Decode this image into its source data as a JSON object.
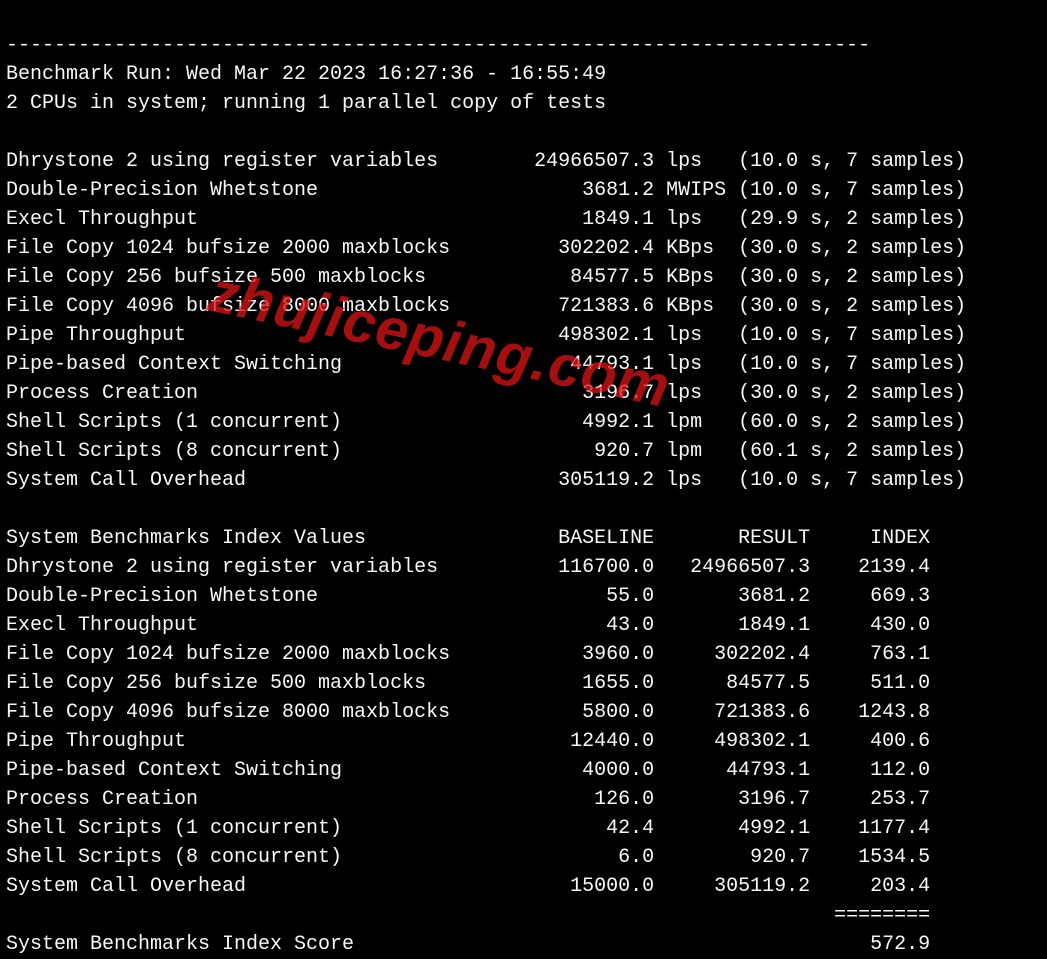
{
  "header": {
    "dashes": "------------------------------------------------------------------------",
    "run_line": "Benchmark Run: Wed Mar 22 2023 16:27:36 - 16:55:49",
    "cpu_line": "2 CPUs in system; running 1 parallel copy of tests"
  },
  "tests": [
    {
      "name": "Dhrystone 2 using register variables",
      "value": "24966507.3",
      "unit": "lps",
      "timing": "(10.0 s, 7 samples)"
    },
    {
      "name": "Double-Precision Whetstone",
      "value": "3681.2",
      "unit": "MWIPS",
      "timing": "(10.0 s, 7 samples)"
    },
    {
      "name": "Execl Throughput",
      "value": "1849.1",
      "unit": "lps",
      "timing": "(29.9 s, 2 samples)"
    },
    {
      "name": "File Copy 1024 bufsize 2000 maxblocks",
      "value": "302202.4",
      "unit": "KBps",
      "timing": "(30.0 s, 2 samples)"
    },
    {
      "name": "File Copy 256 bufsize 500 maxblocks",
      "value": "84577.5",
      "unit": "KBps",
      "timing": "(30.0 s, 2 samples)"
    },
    {
      "name": "File Copy 4096 bufsize 8000 maxblocks",
      "value": "721383.6",
      "unit": "KBps",
      "timing": "(30.0 s, 2 samples)"
    },
    {
      "name": "Pipe Throughput",
      "value": "498302.1",
      "unit": "lps",
      "timing": "(10.0 s, 7 samples)"
    },
    {
      "name": "Pipe-based Context Switching",
      "value": "44793.1",
      "unit": "lps",
      "timing": "(10.0 s, 7 samples)"
    },
    {
      "name": "Process Creation",
      "value": "3196.7",
      "unit": "lps",
      "timing": "(30.0 s, 2 samples)"
    },
    {
      "name": "Shell Scripts (1 concurrent)",
      "value": "4992.1",
      "unit": "lpm",
      "timing": "(60.0 s, 2 samples)"
    },
    {
      "name": "Shell Scripts (8 concurrent)",
      "value": "920.7",
      "unit": "lpm",
      "timing": "(60.1 s, 2 samples)"
    },
    {
      "name": "System Call Overhead",
      "value": "305119.2",
      "unit": "lps",
      "timing": "(10.0 s, 7 samples)"
    }
  ],
  "index_header": {
    "title": "System Benchmarks Index Values",
    "col_baseline": "BASELINE",
    "col_result": "RESULT",
    "col_index": "INDEX"
  },
  "index": [
    {
      "name": "Dhrystone 2 using register variables",
      "baseline": "116700.0",
      "result": "24966507.3",
      "idx": "2139.4"
    },
    {
      "name": "Double-Precision Whetstone",
      "baseline": "55.0",
      "result": "3681.2",
      "idx": "669.3"
    },
    {
      "name": "Execl Throughput",
      "baseline": "43.0",
      "result": "1849.1",
      "idx": "430.0"
    },
    {
      "name": "File Copy 1024 bufsize 2000 maxblocks",
      "baseline": "3960.0",
      "result": "302202.4",
      "idx": "763.1"
    },
    {
      "name": "File Copy 256 bufsize 500 maxblocks",
      "baseline": "1655.0",
      "result": "84577.5",
      "idx": "511.0"
    },
    {
      "name": "File Copy 4096 bufsize 8000 maxblocks",
      "baseline": "5800.0",
      "result": "721383.6",
      "idx": "1243.8"
    },
    {
      "name": "Pipe Throughput",
      "baseline": "12440.0",
      "result": "498302.1",
      "idx": "400.6"
    },
    {
      "name": "Pipe-based Context Switching",
      "baseline": "4000.0",
      "result": "44793.1",
      "idx": "112.0"
    },
    {
      "name": "Process Creation",
      "baseline": "126.0",
      "result": "3196.7",
      "idx": "253.7"
    },
    {
      "name": "Shell Scripts (1 concurrent)",
      "baseline": "42.4",
      "result": "4992.1",
      "idx": "1177.4"
    },
    {
      "name": "Shell Scripts (8 concurrent)",
      "baseline": "6.0",
      "result": "920.7",
      "idx": "1534.5"
    },
    {
      "name": "System Call Overhead",
      "baseline": "15000.0",
      "result": "305119.2",
      "idx": "203.4"
    }
  ],
  "footer": {
    "separator": "========",
    "score_label": "System Benchmarks Index Score",
    "score_value": "572.9"
  },
  "watermark": "zhujiceping.com"
}
